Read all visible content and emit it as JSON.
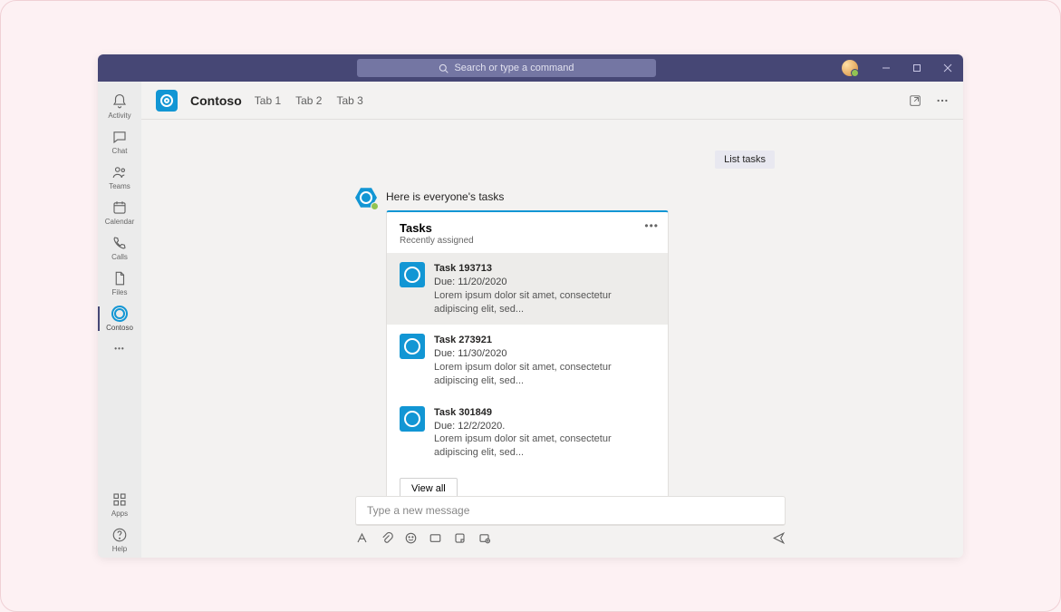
{
  "titlebar": {
    "search_placeholder": "Search or type a command"
  },
  "rail": {
    "items": [
      {
        "label": "Activity"
      },
      {
        "label": "Chat"
      },
      {
        "label": "Teams"
      },
      {
        "label": "Calendar"
      },
      {
        "label": "Calls"
      },
      {
        "label": "Files"
      },
      {
        "label": "Contoso"
      }
    ],
    "more": "•••",
    "apps": "Apps",
    "help": "Help"
  },
  "header": {
    "app_name": "Contoso",
    "tabs": [
      "Tab 1",
      "Tab 2",
      "Tab 3"
    ]
  },
  "pill": "List tasks",
  "message": {
    "intro": "Here is everyone's tasks",
    "card_title": "Tasks",
    "card_subtitle": "Recently assigned",
    "tasks": [
      {
        "title": "Task 193713",
        "due": "Due: 11/20/2020",
        "desc": "Lorem ipsum dolor sit amet, consectetur adipiscing elit, sed..."
      },
      {
        "title": "Task 273921",
        "due": "Due: 11/30/2020",
        "desc": "Lorem ipsum dolor sit amet, consectetur adipiscing elit, sed..."
      },
      {
        "title": "Task 301849",
        "due": "Due: 12/2/2020.",
        "desc": "Lorem ipsum dolor sit amet, consectetur adipiscing elit, sed..."
      }
    ],
    "view_all": "View all"
  },
  "composer": {
    "placeholder": "Type a new message"
  }
}
